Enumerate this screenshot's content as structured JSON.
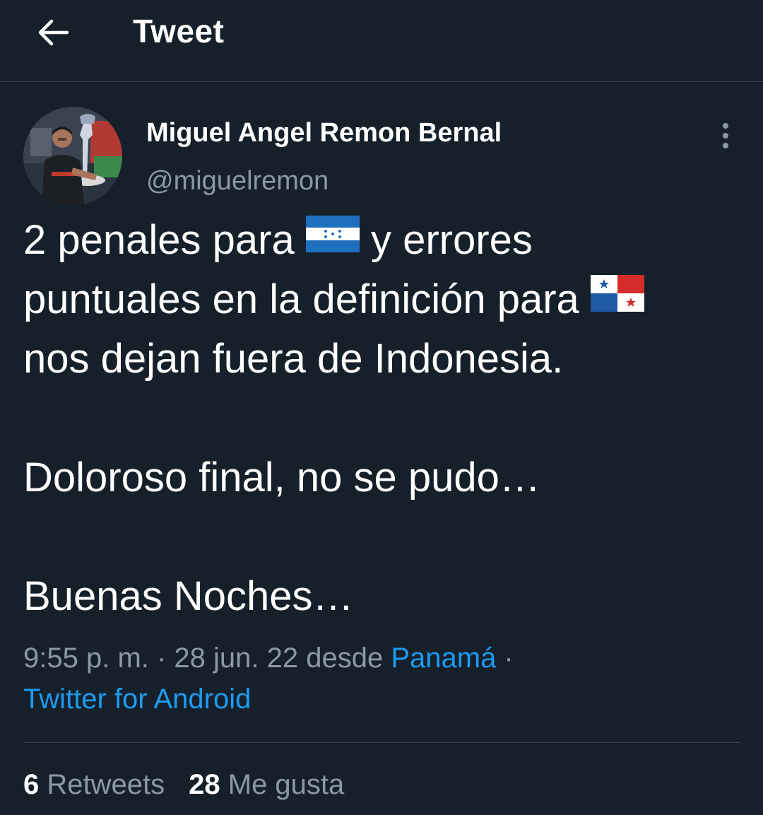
{
  "header": {
    "title": "Tweet",
    "back_icon": "arrow-left-icon"
  },
  "author": {
    "name": "Miguel Angel Remon Bernal",
    "handle": "@miguelremon",
    "avatar_icon": "profile-photo"
  },
  "tweet": {
    "line1_a": "2 penales para",
    "line1_flag": "honduras-flag-icon",
    "line1_b": "y errores",
    "line2_a": "puntuales en la definición para",
    "line2_flag": "panama-flag-icon",
    "line3": "nos dejan fuera de Indonesia.",
    "line4": "Doloroso final, no se pudo…",
    "line5": "Buenas Noches…"
  },
  "meta": {
    "time": "9:55 p. m.",
    "sep1": " · ",
    "date": "28 jun. 22",
    "from": " desde ",
    "location": "Panamá",
    "sep2": " ·",
    "source": "Twitter for Android"
  },
  "stats": {
    "retweets_count": "6",
    "retweets_label": "Retweets",
    "likes_count": "28",
    "likes_label": "Me gusta"
  },
  "colors": {
    "background": "#15202b",
    "muted": "#8b98a5",
    "link": "#1d9bf0",
    "divider": "#38444d"
  }
}
